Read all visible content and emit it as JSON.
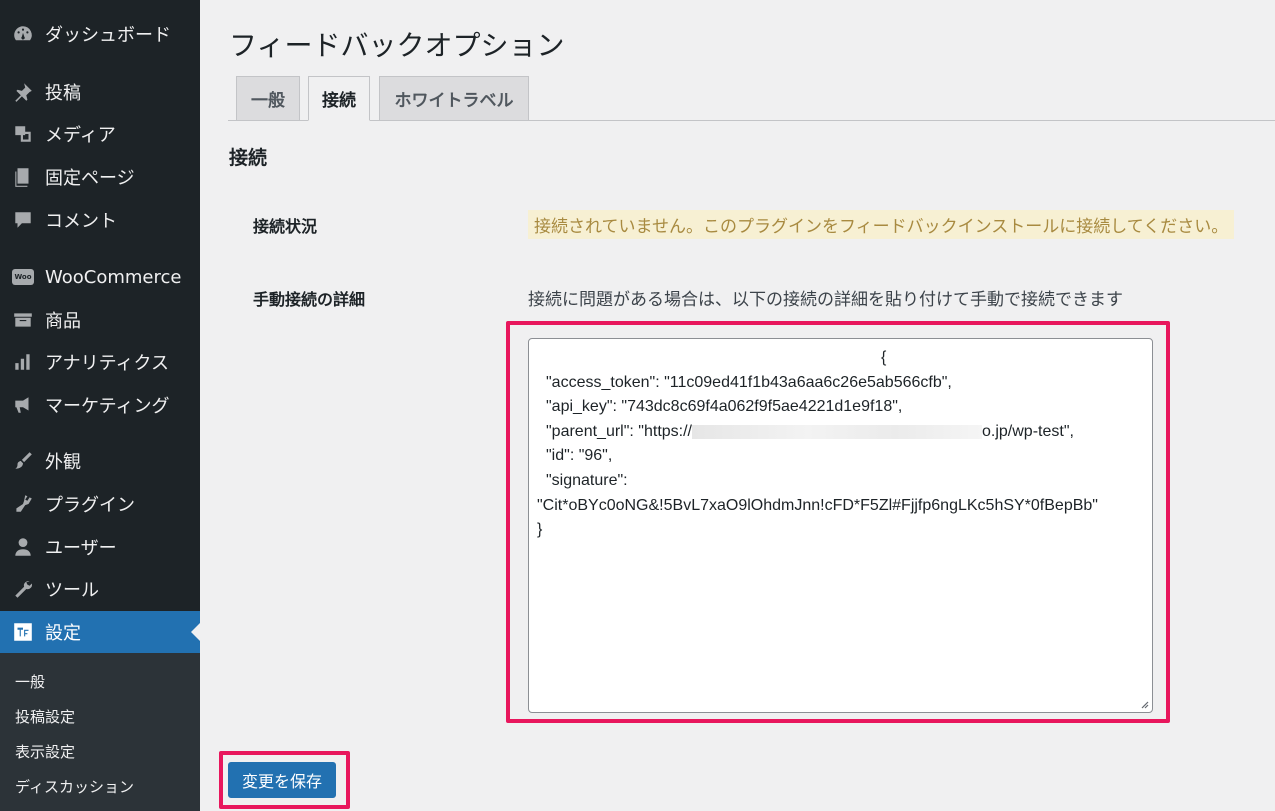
{
  "sidebar": {
    "items": [
      {
        "label": "ダッシュボード",
        "icon": "dashboard-icon"
      },
      {
        "label": "投稿",
        "icon": "pin-icon"
      },
      {
        "label": "メディア",
        "icon": "media-icon"
      },
      {
        "label": "固定ページ",
        "icon": "pages-icon"
      },
      {
        "label": "コメント",
        "icon": "comment-icon"
      },
      {
        "label": "WooCommerce",
        "icon": "woo-icon"
      },
      {
        "label": "商品",
        "icon": "archive-icon"
      },
      {
        "label": "アナリティクス",
        "icon": "bar-chart-icon"
      },
      {
        "label": "マーケティング",
        "icon": "megaphone-icon"
      },
      {
        "label": "外観",
        "icon": "paintbrush-icon"
      },
      {
        "label": "プラグイン",
        "icon": "plugin-icon"
      },
      {
        "label": "ユーザー",
        "icon": "user-icon"
      },
      {
        "label": "ツール",
        "icon": "wrench-icon"
      },
      {
        "label": "設定",
        "icon": "settings-icon"
      }
    ],
    "woo_badge": "Woo",
    "submenu": [
      "一般",
      "投稿設定",
      "表示設定",
      "ディスカッション"
    ]
  },
  "page": {
    "title": "フィードバックオプション",
    "tabs": [
      {
        "label": "一般"
      },
      {
        "label": "接続"
      },
      {
        "label": "ホワイトラベル"
      }
    ],
    "section_title": "接続"
  },
  "connection": {
    "status_label": "接続状況",
    "status_text": "接続されていません。このプラグインをフィードバックインストールに接続してください。",
    "manual_label": "手動接続の詳細",
    "manual_desc": "接続に問題がある場合は、以下の接続の詳細を貼り付けて手動で接続できます",
    "json_lines": [
      "{",
      "\"access_token\": \"11c09ed41f1b43a6aa6c26e5ab566cfb\",",
      "\"api_key\": \"743dc8c69f4a062f9f5ae4221d1e9f18\",",
      "\"id\": \"96\",",
      "\"signature\":",
      "\"Cit*oBYc0oNG&!5BvL7xaO9lOhdmJnn!cFD*F5Zl#Fjjfp6ngLKc5hSY*0fBepBb\"",
      "}"
    ],
    "parent_url_prefix": "\"parent_url\": \"https://",
    "parent_url_suffix": "o.jp/wp-test\","
  },
  "actions": {
    "save_label": "変更を保存"
  },
  "colors": {
    "sidebar_bg": "#1d2327",
    "accent": "#2271b1",
    "highlight": "#e8175d",
    "notice_bg": "#f7f0d3"
  }
}
